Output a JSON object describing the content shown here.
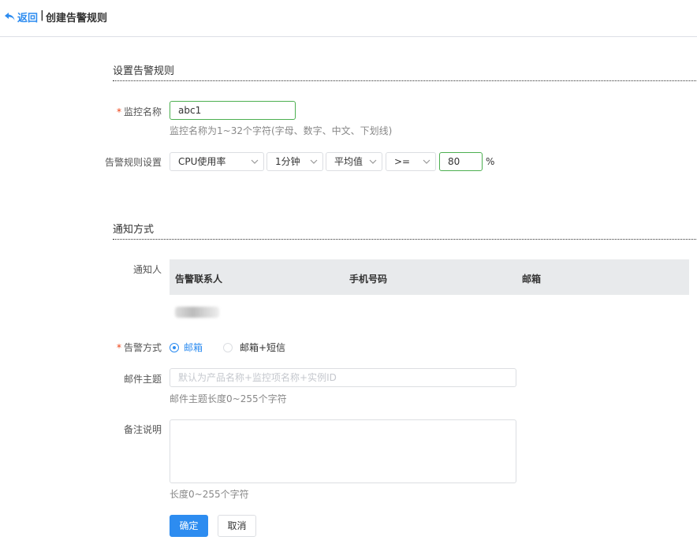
{
  "header": {
    "back_label": "返回",
    "separator": "|",
    "title": "创建告警规则"
  },
  "section_rule": {
    "title": "设置告警规则"
  },
  "monitor_name": {
    "label": "监控名称",
    "required_mark": "*",
    "value": "abc1",
    "hint": "监控名称为1~32个字符(字母、数字、中文、下划线)"
  },
  "rule_setting": {
    "label": "告警规则设置",
    "metric": "CPU使用率",
    "period": "1分钟",
    "statistic": "平均值",
    "operator": ">=",
    "threshold": "80",
    "unit": "%"
  },
  "section_notify": {
    "title": "通知方式"
  },
  "notify": {
    "label": "通知人",
    "columns": [
      "告警联系人",
      "手机号码",
      "邮箱"
    ]
  },
  "alarm_method": {
    "label": "告警方式",
    "required_mark": "*",
    "options": [
      "邮箱",
      "邮箱+短信"
    ],
    "selected": "邮箱"
  },
  "mail_subject": {
    "label": "邮件主题",
    "placeholder": "默认为产品名称+监控项名称+实例ID",
    "hint": "邮件主题长度0~255个字符"
  },
  "remark": {
    "label": "备注说明",
    "hint": "长度0~255个字符"
  },
  "actions": {
    "confirm": "确定",
    "cancel": "取消"
  },
  "colors": {
    "primary": "#2d8cf0",
    "valid_border": "#4caf50",
    "required": "#ed4014"
  }
}
